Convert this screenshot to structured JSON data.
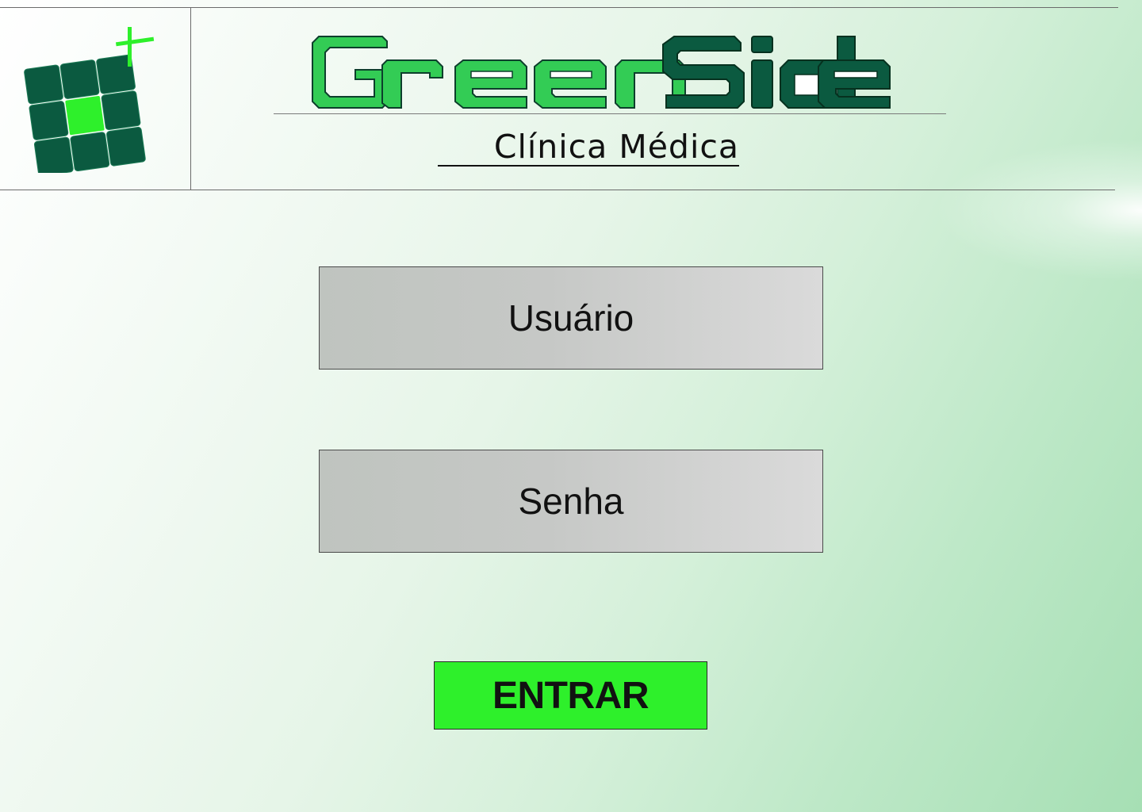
{
  "header": {
    "brand_part1": "Green",
    "brand_part2": "Side",
    "subtitle": "Clínica Médica",
    "logo_icon": "grid-plus-logo-icon"
  },
  "login": {
    "username_placeholder": "Usuário",
    "password_placeholder": "Senha",
    "submit_label": "ENTRAR"
  },
  "colors": {
    "brand_light_green": "#33cc55",
    "brand_dark_green": "#0b5a40",
    "accent_green": "#2ef02b",
    "field_gray": "#c6c8c6",
    "text": "#111111"
  }
}
